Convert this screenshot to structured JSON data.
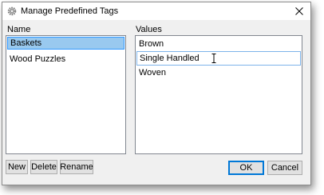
{
  "window": {
    "title": "Manage Predefined Tags",
    "close_glyph": "✕"
  },
  "names": {
    "header": "Name",
    "items": [
      {
        "label": "Baskets",
        "selected": true
      },
      {
        "label": "Wood Puzzles",
        "selected": false
      }
    ]
  },
  "values": {
    "header": "Values",
    "items": [
      {
        "label": "Brown",
        "editing": false
      },
      {
        "label": "Single Handled",
        "editing": true
      },
      {
        "label": "Woven",
        "editing": false
      }
    ]
  },
  "buttons": {
    "new": "New",
    "delete": "Delete",
    "rename": "Rename",
    "ok": "OK",
    "cancel": "Cancel"
  },
  "colors": {
    "selection_fill": "#99c9ef",
    "selection_border": "#3399ff",
    "default_button_border": "#0078d7"
  }
}
